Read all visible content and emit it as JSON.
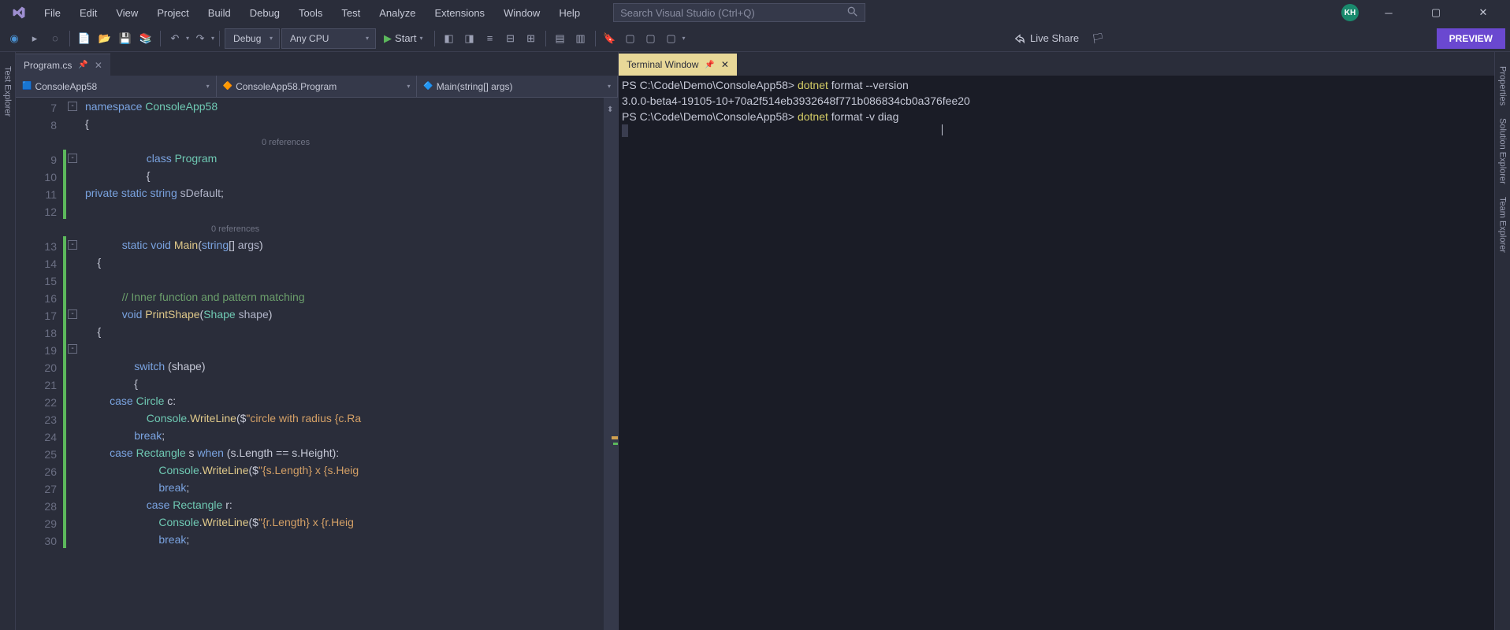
{
  "menu": {
    "items": [
      "File",
      "Edit",
      "View",
      "Project",
      "Build",
      "Debug",
      "Tools",
      "Test",
      "Analyze",
      "Extensions",
      "Window",
      "Help"
    ]
  },
  "search": {
    "placeholder": "Search Visual Studio (Ctrl+Q)"
  },
  "avatar": {
    "initials": "KH"
  },
  "toolbar": {
    "config": "Debug",
    "platform": "Any CPU",
    "start": "Start",
    "liveShare": "Live Share",
    "preview": "PREVIEW"
  },
  "leftPanel": {
    "tab": "Test Explorer"
  },
  "rightPanel": {
    "tabs": [
      "Properties",
      "Solution Explorer",
      "Team Explorer"
    ]
  },
  "editor": {
    "tab": {
      "name": "Program.cs"
    },
    "context": {
      "project": "ConsoleApp58",
      "class": "ConsoleApp58.Program",
      "method": "Main(string[] args)"
    },
    "lines": [
      {
        "n": 7,
        "fold": "-",
        "code": [
          [
            "kw",
            "namespace"
          ],
          [
            "punc",
            " "
          ],
          [
            "type",
            "ConsoleApp58"
          ]
        ]
      },
      {
        "n": 8,
        "code": [
          [
            "punc",
            "{"
          ]
        ]
      },
      {
        "n": "",
        "codelens": "0 references",
        "indent": 28
      },
      {
        "n": 9,
        "fold": "-",
        "ch": true,
        "code": [
          [
            "punc",
            "                    "
          ],
          [
            "kw",
            "class"
          ],
          [
            "punc",
            " "
          ],
          [
            "type",
            "Program"
          ]
        ]
      },
      {
        "n": 10,
        "ch": true,
        "code": [
          [
            "punc",
            "                    {"
          ]
        ]
      },
      {
        "n": 11,
        "ch": true,
        "code": [
          [
            "kw",
            "private"
          ],
          [
            "punc",
            " "
          ],
          [
            "kw",
            "static"
          ],
          [
            "punc",
            " "
          ],
          [
            "kw",
            "string"
          ],
          [
            "punc",
            " "
          ],
          [
            "param",
            "sDefault"
          ],
          [
            "punc",
            ";"
          ]
        ]
      },
      {
        "n": 12,
        "ch": true,
        "code": [
          [
            "punc",
            ""
          ]
        ]
      },
      {
        "n": "",
        "codelens": "0 references",
        "indent": 20
      },
      {
        "n": 13,
        "fold": "-",
        "ch": true,
        "code": [
          [
            "punc",
            "            "
          ],
          [
            "kw",
            "static"
          ],
          [
            "punc",
            " "
          ],
          [
            "kw",
            "void"
          ],
          [
            "punc",
            " "
          ],
          [
            "method",
            "Main"
          ],
          [
            "punc",
            "("
          ],
          [
            "kw",
            "string"
          ],
          [
            "punc",
            "[] "
          ],
          [
            "param",
            "args"
          ],
          [
            "punc",
            ")"
          ]
        ]
      },
      {
        "n": 14,
        "ch": true,
        "code": [
          [
            "punc",
            "    {"
          ]
        ]
      },
      {
        "n": 15,
        "ch": true,
        "code": [
          [
            "punc",
            ""
          ]
        ]
      },
      {
        "n": 16,
        "ch": true,
        "code": [
          [
            "punc",
            "            "
          ],
          [
            "comment",
            "// Inner function and pattern matching"
          ]
        ]
      },
      {
        "n": 17,
        "fold": "-",
        "ch": true,
        "code": [
          [
            "punc",
            "            "
          ],
          [
            "kw",
            "void"
          ],
          [
            "punc",
            " "
          ],
          [
            "method",
            "PrintShape"
          ],
          [
            "punc",
            "("
          ],
          [
            "type",
            "Shape"
          ],
          [
            "punc",
            " "
          ],
          [
            "param",
            "shape"
          ],
          [
            "punc",
            ")"
          ]
        ]
      },
      {
        "n": 18,
        "ch": true,
        "code": [
          [
            "punc",
            "    {"
          ]
        ]
      },
      {
        "n": 19,
        "fold": "-",
        "ch": true,
        "code": [
          [
            "punc",
            ""
          ]
        ]
      },
      {
        "n": 20,
        "ch": true,
        "code": [
          [
            "punc",
            "                "
          ],
          [
            "kw",
            "switch"
          ],
          [
            "punc",
            " (shape)"
          ]
        ]
      },
      {
        "n": 21,
        "ch": true,
        "code": [
          [
            "punc",
            "                {"
          ]
        ]
      },
      {
        "n": 22,
        "ch": true,
        "code": [
          [
            "punc",
            "        "
          ],
          [
            "kw",
            "case"
          ],
          [
            "punc",
            " "
          ],
          [
            "type",
            "Circle"
          ],
          [
            "punc",
            " c:"
          ]
        ]
      },
      {
        "n": 23,
        "ch": true,
        "code": [
          [
            "punc",
            "                    "
          ],
          [
            "type",
            "Console"
          ],
          [
            "punc",
            "."
          ],
          [
            "method",
            "WriteLine"
          ],
          [
            "punc",
            "($"
          ],
          [
            "string",
            "\"circle with radius {c.Ra"
          ]
        ]
      },
      {
        "n": 24,
        "ch": true,
        "code": [
          [
            "punc",
            "                "
          ],
          [
            "kw",
            "break"
          ],
          [
            "punc",
            ";"
          ]
        ]
      },
      {
        "n": 25,
        "ch": true,
        "code": [
          [
            "punc",
            "        "
          ],
          [
            "kw",
            "case"
          ],
          [
            "punc",
            " "
          ],
          [
            "type",
            "Rectangle"
          ],
          [
            "punc",
            " s "
          ],
          [
            "kw",
            "when"
          ],
          [
            "punc",
            " (s.Length == s.Height):"
          ]
        ]
      },
      {
        "n": 26,
        "ch": true,
        "code": [
          [
            "punc",
            "                        "
          ],
          [
            "type",
            "Console"
          ],
          [
            "punc",
            "."
          ],
          [
            "method",
            "WriteLine"
          ],
          [
            "punc",
            "($"
          ],
          [
            "string",
            "\"{s.Length} x {s.Heig"
          ]
        ]
      },
      {
        "n": 27,
        "ch": true,
        "code": [
          [
            "punc",
            "                        "
          ],
          [
            "kw",
            "break"
          ],
          [
            "punc",
            ";"
          ]
        ]
      },
      {
        "n": 28,
        "ch": true,
        "code": [
          [
            "punc",
            "                    "
          ],
          [
            "kw",
            "case"
          ],
          [
            "punc",
            " "
          ],
          [
            "type",
            "Rectangle"
          ],
          [
            "punc",
            " r:"
          ]
        ]
      },
      {
        "n": 29,
        "ch": true,
        "code": [
          [
            "punc",
            "                        "
          ],
          [
            "type",
            "Console"
          ],
          [
            "punc",
            "."
          ],
          [
            "method",
            "WriteLine"
          ],
          [
            "punc",
            "($"
          ],
          [
            "string",
            "\"{r.Length} x {r.Heig"
          ]
        ]
      },
      {
        "n": 30,
        "ch": true,
        "code": [
          [
            "punc",
            "                        "
          ],
          [
            "kw",
            "break"
          ],
          [
            "punc",
            ";"
          ]
        ]
      }
    ]
  },
  "terminal": {
    "tab": "Terminal Window",
    "lines": [
      {
        "prompt": "PS C:\\Code\\Demo\\ConsoleApp58>",
        "cmd": "dotnet",
        "args": " format --version"
      },
      {
        "output": "3.0.0-beta4-19105-10+70a2f514eb3932648f771b086834cb0a376fee20"
      },
      {
        "prompt": "PS C:\\Code\\Demo\\ConsoleApp58>",
        "cmd": "dotnet",
        "args": " format -v diag"
      }
    ]
  }
}
